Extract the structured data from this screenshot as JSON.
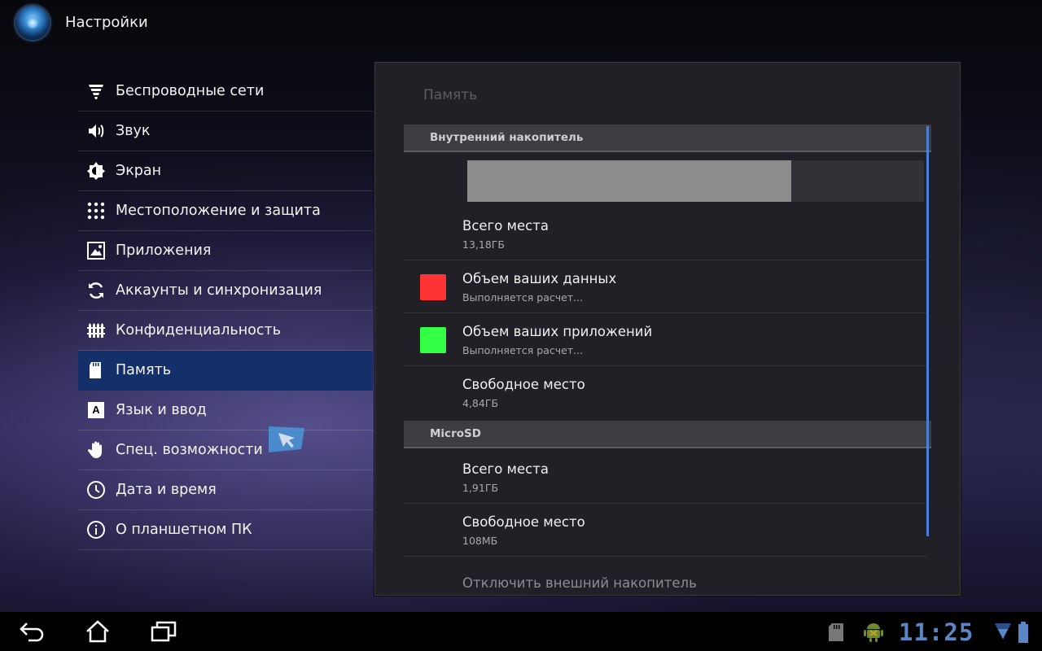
{
  "app": {
    "title": "Настройки"
  },
  "sidebar": {
    "items": [
      {
        "label": "Беспроводные сети",
        "icon": "wifi-icon"
      },
      {
        "label": "Звук",
        "icon": "speaker-icon"
      },
      {
        "label": "Экран",
        "icon": "brightness-icon"
      },
      {
        "label": "Местоположение и защита",
        "icon": "pattern-lock-icon"
      },
      {
        "label": "Приложения",
        "icon": "apps-icon"
      },
      {
        "label": "Аккаунты и синхронизация",
        "icon": "sync-icon"
      },
      {
        "label": "Конфиденциальность",
        "icon": "fence-icon"
      },
      {
        "label": "Память",
        "icon": "sd-card-icon",
        "selected": true
      },
      {
        "label": "Язык и ввод",
        "icon": "keyboard-a-icon"
      },
      {
        "label": "Спец. возможности",
        "icon": "hand-icon"
      },
      {
        "label": "Дата и время",
        "icon": "clock-icon"
      },
      {
        "label": "О планшетном ПК",
        "icon": "info-icon"
      }
    ]
  },
  "storage": {
    "title": "Память",
    "internal": {
      "header": "Внутренний накопитель",
      "used_fraction": 0.71,
      "total_label": "Всего места",
      "total_value": "13,18ГБ",
      "data_label": "Объем ваших данных",
      "data_value": "Выполняется расчет...",
      "data_color": "#ff3333",
      "apps_label": "Объем ваших приложений",
      "apps_value": "Выполняется расчет...",
      "apps_color": "#33ff44",
      "free_label": "Свободное место",
      "free_value": "4,84ГБ"
    },
    "sd": {
      "header": "MicroSD",
      "total_label": "Всего места",
      "total_value": "1,91ГБ",
      "free_label": "Свободное место",
      "free_value": "108МБ"
    },
    "unmount_label": "Отключить внешний накопитель"
  },
  "statusbar": {
    "time": "11:25",
    "icons": [
      "sd-card-icon",
      "android-debug-icon",
      "wifi-signal-icon",
      "battery-icon"
    ]
  },
  "navbar": {
    "buttons": [
      "back-icon",
      "home-icon",
      "recent-apps-icon"
    ]
  },
  "colors": {
    "accent": "#4a7fd8",
    "selected": "#13306a",
    "clock": "#5a86c6"
  }
}
